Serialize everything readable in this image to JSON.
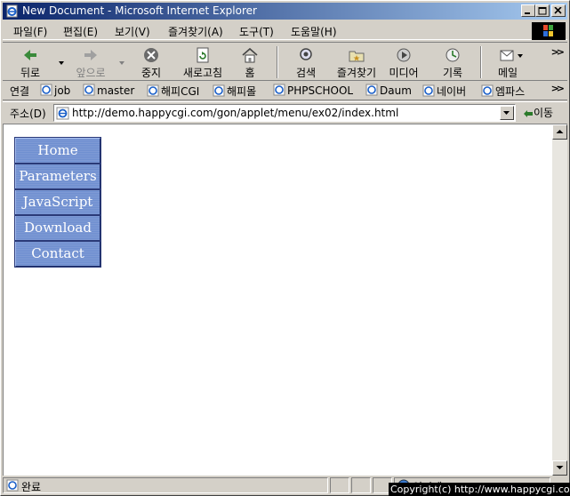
{
  "window": {
    "title": "New Document - Microsoft Internet Explorer"
  },
  "menubar": {
    "items": [
      "파일(F)",
      "편집(E)",
      "보기(V)",
      "즐겨찾기(A)",
      "도구(T)",
      "도움말(H)"
    ]
  },
  "toolbar": {
    "back": "뒤로",
    "forward": "앞으로",
    "stop": "중지",
    "refresh": "새로고침",
    "home": "홈",
    "search": "검색",
    "favorites": "즐겨찾기",
    "media": "미디어",
    "history": "기록",
    "mail": "메일"
  },
  "links": {
    "label": "연결",
    "items": [
      "job",
      "master",
      "해피CGI",
      "해피몰",
      "PHPSCHOOL",
      "Daum",
      "네이버",
      "엠파스"
    ]
  },
  "address": {
    "label": "주소(D)",
    "url": "http://demo.happycgi.com/gon/applet/menu/ex02/index.html",
    "go": "이동"
  },
  "page": {
    "menu": [
      "Home",
      "Parameters",
      "JavaScript",
      "Download",
      "Contact"
    ]
  },
  "status": {
    "text": "완료",
    "zone": "인터넷",
    "copyright": "Copyright(c) http://www.happycgi.com"
  },
  "colors": {
    "titlebar_start": "#0a246a",
    "titlebar_end": "#a6caf0",
    "menu_button": "#6f8fd0"
  }
}
